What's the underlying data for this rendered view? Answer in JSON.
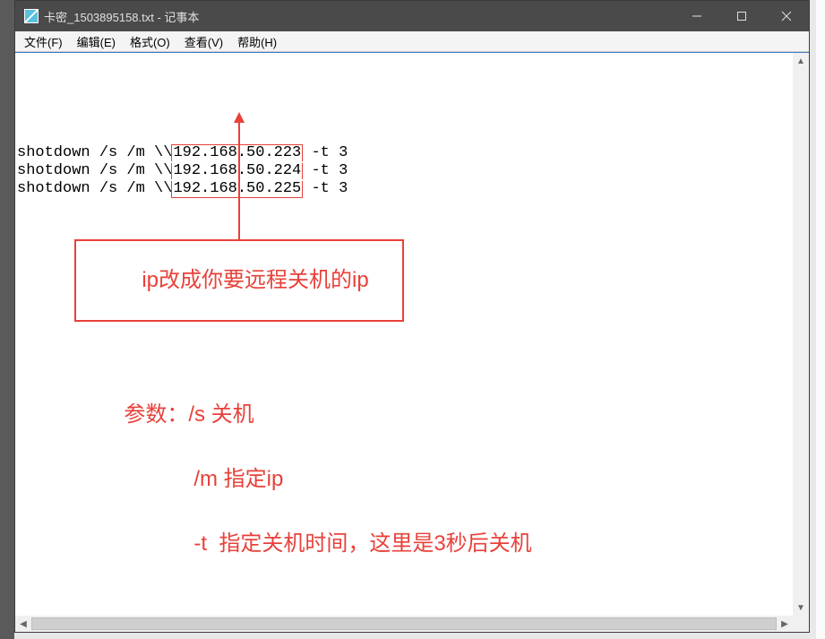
{
  "window": {
    "title": "卡密_1503895158.txt - 记事本"
  },
  "menu": {
    "file": "文件(F)",
    "edit": "编辑(E)",
    "format": "格式(O)",
    "view": "查看(V)",
    "help": "帮助(H)"
  },
  "text": {
    "prefix": "shotdown /s /m \\\\",
    "suffix": " -t 3",
    "ips": [
      "192.168.50.223",
      "192.168.50.224",
      "192.168.50.225"
    ]
  },
  "annotation": {
    "box": "ip改成你要远程关机的ip",
    "params_label": "参数：",
    "p1": "/s 关机",
    "p2": "/m 指定ip",
    "p3": "-t  指定关机时间，这里是3秒后关机"
  }
}
